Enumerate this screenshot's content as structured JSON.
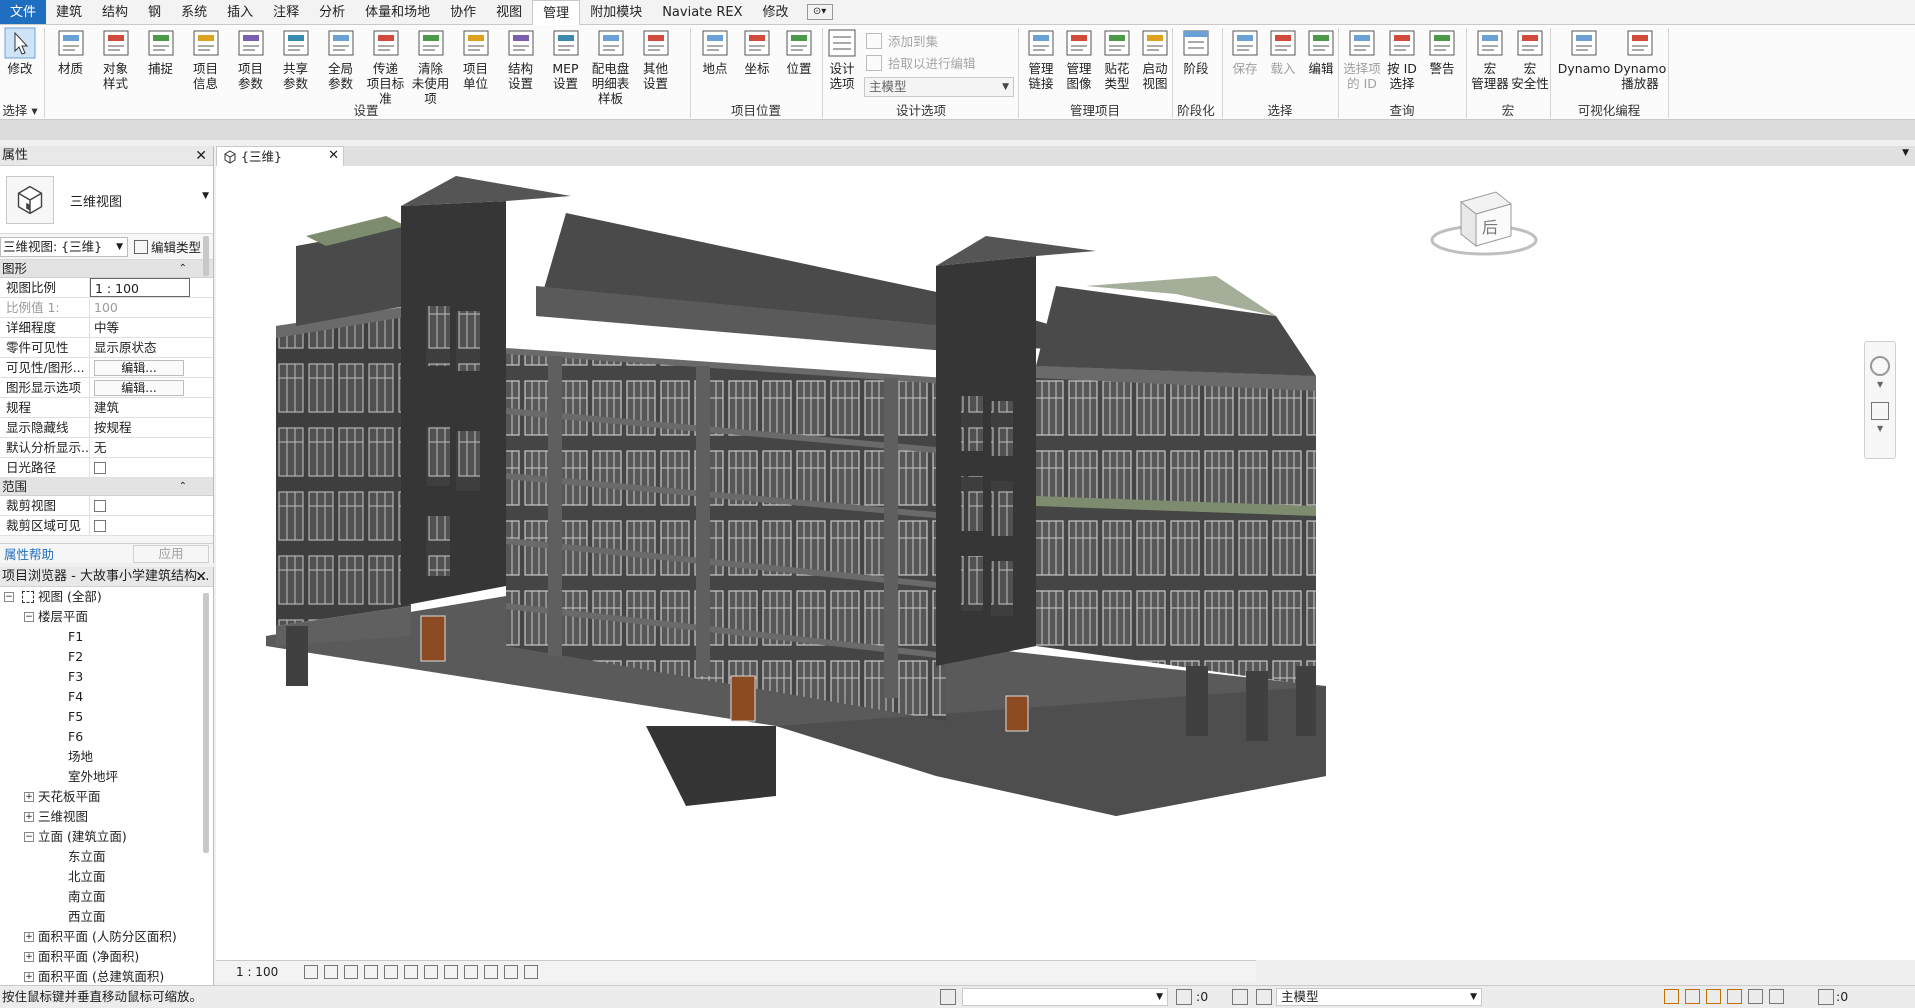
{
  "menu": {
    "tabs": [
      "文件",
      "建筑",
      "结构",
      "钢",
      "系统",
      "插入",
      "注释",
      "分析",
      "体量和场地",
      "协作",
      "视图",
      "管理",
      "附加模块",
      "Naviate REX",
      "修改"
    ],
    "active_tab": "管理"
  },
  "ribbon": {
    "modify": {
      "label": "修改",
      "group": "选择"
    },
    "settings_buttons": [
      {
        "label1": "材质",
        "label2": ""
      },
      {
        "label1": "对象",
        "label2": "样式"
      },
      {
        "label1": "捕捉",
        "label2": ""
      },
      {
        "label1": "项目",
        "label2": "信息"
      },
      {
        "label1": "项目",
        "label2": "参数"
      },
      {
        "label1": "共享",
        "label2": "参数"
      },
      {
        "label1": "全局",
        "label2": "参数"
      },
      {
        "label1": "传递",
        "label2": "项目标准"
      },
      {
        "label1": "清除",
        "label2": "未使用项"
      },
      {
        "label1": "项目",
        "label2": "单位"
      },
      {
        "label1": "结构",
        "label2": "设置"
      },
      {
        "label1": "MEP",
        "label2": "设置"
      },
      {
        "label1": "配电盘明细表",
        "label2": "样板"
      },
      {
        "label1": "其他",
        "label2": "设置"
      }
    ],
    "settings_group": "设置",
    "location_buttons": [
      {
        "label1": "地点",
        "label2": ""
      },
      {
        "label1": "坐标",
        "label2": ""
      },
      {
        "label1": "位置",
        "label2": ""
      }
    ],
    "location_group": "项目位置",
    "design_options": {
      "button_label1": "设计",
      "button_label2": "选项",
      "add_to_set": "添加到集",
      "pick_to_edit": "拾取以进行编辑",
      "main_model": "主模型",
      "group": "设计选项"
    },
    "manage_project_buttons": [
      {
        "label1": "管理",
        "label2": "链接"
      },
      {
        "label1": "管理",
        "label2": "图像"
      },
      {
        "label1": "贴花",
        "label2": "类型"
      },
      {
        "label1": "启动",
        "label2": "视图"
      }
    ],
    "manage_project_group": "管理项目",
    "phasing": {
      "label": "阶段",
      "group": "阶段化"
    },
    "selection_buttons": [
      {
        "label1": "保存",
        "label2": ""
      },
      {
        "label1": "载入",
        "label2": ""
      },
      {
        "label1": "编辑",
        "label2": ""
      }
    ],
    "selection_group": "选择",
    "inquiry_buttons": [
      {
        "label1": "选择项",
        "label2": "的 ID"
      },
      {
        "label1": "按 ID",
        "label2": "选择"
      },
      {
        "label1": "警告",
        "label2": ""
      }
    ],
    "inquiry_group": "查询",
    "macro_buttons": [
      {
        "label1": "宏",
        "label2": "管理器"
      },
      {
        "label1": "宏",
        "label2": "安全性"
      }
    ],
    "macro_group": "宏",
    "dynamo_buttons": [
      {
        "label1": "Dynamo",
        "label2": ""
      },
      {
        "label1": "Dynamo",
        "label2": "播放器"
      }
    ],
    "dynamo_group": "可视化编程"
  },
  "properties": {
    "title": "属性",
    "type_name": "三维视图",
    "view_selector": "三维视图: {三维}",
    "edit_type": "编辑类型",
    "section_graphics": "图形",
    "rows": [
      {
        "k": "视图比例",
        "v": "1 : 100"
      },
      {
        "k": "比例值 1:",
        "v": "100"
      },
      {
        "k": "详细程度",
        "v": "中等"
      },
      {
        "k": "零件可见性",
        "v": "显示原状态"
      },
      {
        "k": "可见性/图形...",
        "v": "编辑..."
      },
      {
        "k": "图形显示选项",
        "v": "编辑..."
      },
      {
        "k": "规程",
        "v": "建筑"
      },
      {
        "k": "显示隐藏线",
        "v": "按规程"
      },
      {
        "k": "默认分析显示...",
        "v": "无"
      },
      {
        "k": "日光路径",
        "v": ""
      }
    ],
    "section_extents": "范围",
    "extent_rows": [
      {
        "k": "裁剪视图",
        "v": ""
      },
      {
        "k": "裁剪区域可见",
        "v": ""
      }
    ],
    "help_link": "属性帮助",
    "apply": "应用"
  },
  "browser": {
    "title": "项目浏览器 - 大故事小学建筑结构...",
    "nodes": [
      {
        "label": "视图 (全部)",
        "level": 0,
        "exp": "−"
      },
      {
        "label": "楼层平面",
        "level": 1,
        "exp": "−"
      },
      {
        "label": "F1",
        "level": 2,
        "exp": ""
      },
      {
        "label": "F2",
        "level": 2,
        "exp": ""
      },
      {
        "label": "F3",
        "level": 2,
        "exp": ""
      },
      {
        "label": "F4",
        "level": 2,
        "exp": ""
      },
      {
        "label": "F5",
        "level": 2,
        "exp": ""
      },
      {
        "label": "F6",
        "level": 2,
        "exp": ""
      },
      {
        "label": "场地",
        "level": 2,
        "exp": ""
      },
      {
        "label": "室外地坪",
        "level": 2,
        "exp": ""
      },
      {
        "label": "天花板平面",
        "level": 1,
        "exp": "+"
      },
      {
        "label": "三维视图",
        "level": 1,
        "exp": "+"
      },
      {
        "label": "立面 (建筑立面)",
        "level": 1,
        "exp": "−"
      },
      {
        "label": "东立面",
        "level": 2,
        "exp": ""
      },
      {
        "label": "北立面",
        "level": 2,
        "exp": ""
      },
      {
        "label": "南立面",
        "level": 2,
        "exp": ""
      },
      {
        "label": "西立面",
        "level": 2,
        "exp": ""
      },
      {
        "label": "面积平面 (人防分区面积)",
        "level": 1,
        "exp": "+"
      },
      {
        "label": "面积平面 (净面积)",
        "level": 1,
        "exp": "+"
      },
      {
        "label": "面积平面 (总建筑面积)",
        "level": 1,
        "exp": "+"
      }
    ]
  },
  "view": {
    "tab_label": "{三维}",
    "scale": "1 : 100",
    "viewcube_face": "后"
  },
  "status": {
    "message": "按住鼠标键并垂直移动鼠标可缩放。",
    "zero1": ":0",
    "main_model": "主模型",
    "filter_count": ":0"
  },
  "colors": {
    "accent": "#1f6ebf",
    "building_dark": "#3a3a3a",
    "building_face": "#4b4b4b",
    "window_frame": "#bfbfbf",
    "trim_green": "#7d8b6e",
    "door_wood": "#8b4a22"
  }
}
